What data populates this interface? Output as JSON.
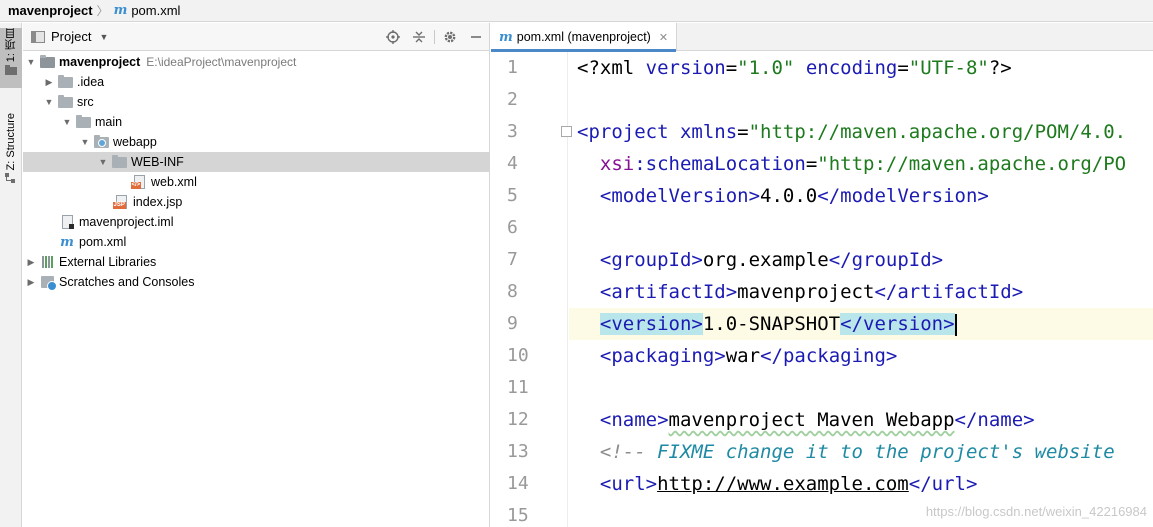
{
  "breadcrumb": {
    "project": "mavenproject",
    "file": "pom.xml",
    "file_icon": "m"
  },
  "tool_strip": {
    "project_label": "1: 项目",
    "structure_label": "Z: Structure"
  },
  "project_panel": {
    "title": "Project",
    "tree": [
      {
        "label": "mavenproject",
        "path": "E:\\ideaProject\\mavenproject"
      },
      {
        "label": ".idea"
      },
      {
        "label": "src"
      },
      {
        "label": "main"
      },
      {
        "label": "webapp"
      },
      {
        "label": "WEB-INF"
      },
      {
        "label": "web.xml"
      },
      {
        "label": "index.jsp"
      },
      {
        "label": "mavenproject.iml"
      },
      {
        "label": "pom.xml"
      },
      {
        "label": "External Libraries"
      },
      {
        "label": "Scratches and Consoles"
      }
    ]
  },
  "editor": {
    "tab_label": "pom.xml (mavenproject)",
    "line_numbers": [
      "1",
      "2",
      "3",
      "4",
      "5",
      "6",
      "7",
      "8",
      "9",
      "10",
      "11",
      "12",
      "13",
      "14",
      "15"
    ],
    "code": {
      "l1_a": "<?xml ",
      "l1_b": "version",
      "l1_c": "=",
      "l1_d": "\"1.0\"",
      "l1_e": " encoding",
      "l1_f": "=",
      "l1_g": "\"UTF-8\"",
      "l1_h": "?>",
      "l3_a": "<project ",
      "l3_b": "xmlns",
      "l3_c": "=",
      "l3_d": "\"http://maven.apache.org/POM/4.0.",
      "l4_a": "xsi",
      "l4_b": ":schemaLocation",
      "l4_c": "=",
      "l4_d": "\"http://maven.apache.org/PO",
      "l5_a": "<modelVersion>",
      "l5_b": "4.0.0",
      "l5_c": "</modelVersion>",
      "l7_a": "<groupId>",
      "l7_b": "org.example",
      "l7_c": "</groupId>",
      "l8_a": "<artifactId>",
      "l8_b": "mavenproject",
      "l8_c": "</artifactId>",
      "l9_a": "<version>",
      "l9_b": "1.0-SNAPSHOT",
      "l9_c": "</version>",
      "l10_a": "<packaging>",
      "l10_b": "war",
      "l10_c": "</packaging>",
      "l12_a": "<name>",
      "l12_b": "mavenproject Maven Webapp",
      "l12_c": "</name>",
      "l13_a": "<!-- ",
      "l13_b": "FIXME change it to the project's website",
      "l14_a": "<url>",
      "l14_b": "http://www.example.com",
      "l14_c": "</url>"
    }
  },
  "watermark": "https://blog.csdn.net/weixin_42216984",
  "colors": {
    "tag": "#1b1bb3",
    "value": "#1d7a1d",
    "comment": "#8c8c8c",
    "current_line": "#fdfbe6",
    "tag_highlight": "#b9e6ea",
    "tab_underline": "#4a88c7"
  }
}
